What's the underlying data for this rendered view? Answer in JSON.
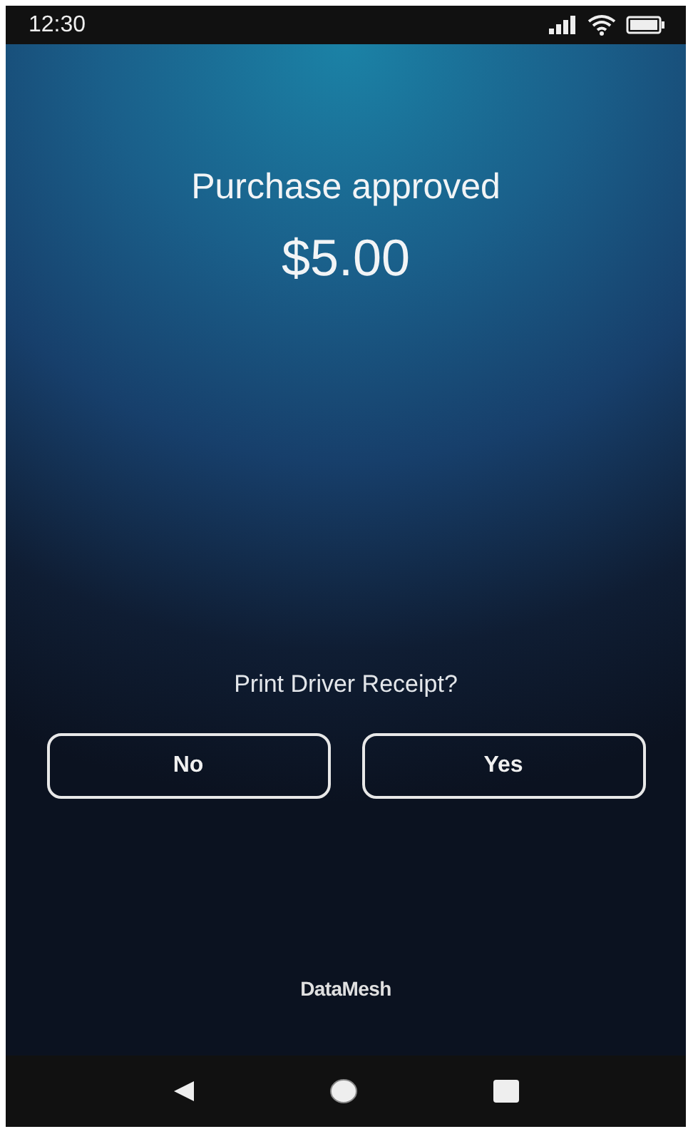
{
  "status_bar": {
    "time": "12:30"
  },
  "title": "Purchase approved",
  "amount": "$5.00",
  "prompt": "Print Driver Receipt?",
  "buttons": [
    "No",
    "Yes"
  ],
  "brand": "DataMesh"
}
